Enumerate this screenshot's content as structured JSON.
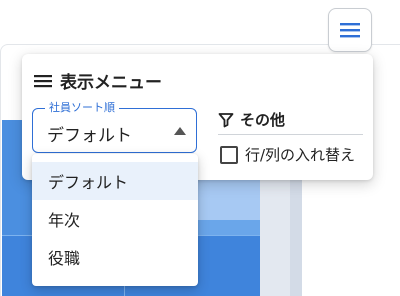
{
  "menu_button": {
    "icon": "hamburger-icon"
  },
  "panel": {
    "title": "表示メニュー",
    "title_icon": "hamburger-icon",
    "sort_select": {
      "label": "社員ソート順",
      "value": "デフォルト"
    },
    "other": {
      "label": "その他",
      "icon": "filter-icon",
      "checkbox_label": "行/列の入れ替え",
      "checked": false
    }
  },
  "dropdown": {
    "options": [
      "デフォルト",
      "年次",
      "役職"
    ],
    "selected_index": 0
  },
  "colors": {
    "accent": "#2f6fd6",
    "highlight": "#e9f1fb"
  }
}
